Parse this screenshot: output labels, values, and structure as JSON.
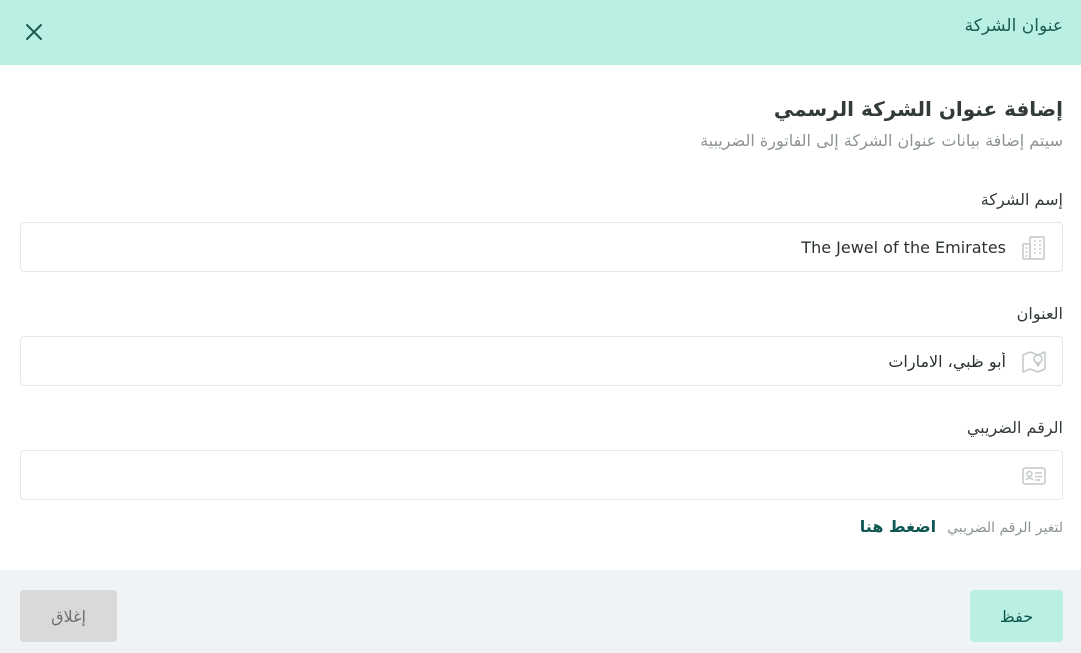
{
  "header": {
    "title": "عنوان الشركة",
    "close_icon": "close-icon"
  },
  "section": {
    "title": "إضافة عنوان الشركة الرسمي",
    "subtitle": "سيتم إضافة بيانات عنوان الشركة إلى الفاتورة الضريبية"
  },
  "fields": {
    "company_name": {
      "label": "إسم الشركة",
      "value": "The Jewel of the Emirates",
      "placeholder": "",
      "icon": "building-icon"
    },
    "address": {
      "label": "العنوان",
      "value": "أبو ظبي، الامارات",
      "placeholder": "",
      "icon": "map-pin-icon"
    },
    "tax_number": {
      "label": "الرقم الضريبي",
      "value": "",
      "placeholder": "",
      "icon": "id-card-icon"
    }
  },
  "tax_note": {
    "text": "لتغير الرقم الضريبي",
    "link": "اضغط هنا"
  },
  "footer": {
    "save_label": "حفظ",
    "close_label": "إغلاق"
  },
  "colors": {
    "header_bg": "#baf0e3",
    "accent": "#0f5752",
    "footer_bg": "#f0f3f5"
  }
}
